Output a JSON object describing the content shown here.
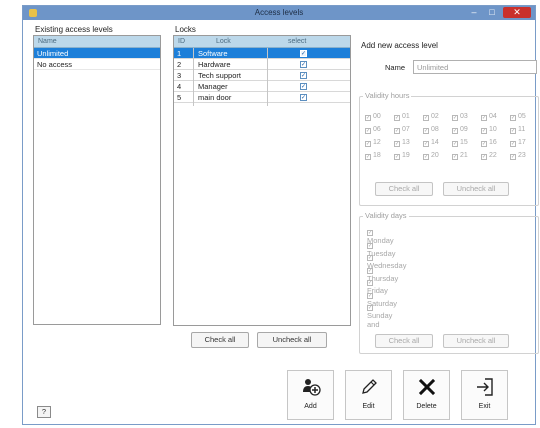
{
  "window": {
    "title": "Access levels",
    "minimize_glyph": "–",
    "maximize_glyph": "□",
    "close_glyph": "✕"
  },
  "existing": {
    "label": "Existing access levels",
    "header": "Name",
    "items": [
      "Unlimited",
      "No access"
    ],
    "selected_index": 0
  },
  "locks": {
    "label": "Locks",
    "columns": {
      "id": "ID",
      "lock": "Lock",
      "select": "select"
    },
    "rows": [
      {
        "id": "1",
        "lock": "Software",
        "selected": true
      },
      {
        "id": "2",
        "lock": "Hardware",
        "selected": true
      },
      {
        "id": "3",
        "lock": "Tech support",
        "selected": true
      },
      {
        "id": "4",
        "lock": "Manager",
        "selected": true
      },
      {
        "id": "5",
        "lock": "main door",
        "selected": true
      }
    ],
    "check_all": "Check all",
    "uncheck_all": "Uncheck all"
  },
  "add_level": {
    "label": "Add new access level",
    "name_label": "Name",
    "name_value": "Unlimited"
  },
  "validity_hours": {
    "label": "Validity hours",
    "hours": [
      "00",
      "01",
      "02",
      "03",
      "04",
      "05",
      "06",
      "07",
      "08",
      "09",
      "10",
      "11",
      "12",
      "13",
      "14",
      "15",
      "16",
      "17",
      "18",
      "19",
      "20",
      "21",
      "22",
      "23"
    ],
    "check_all": "Check all",
    "uncheck_all": "Uncheck all"
  },
  "validity_days": {
    "label": "Validity days",
    "days": [
      "Monday",
      "Tuesday",
      "Wednesday",
      "Thursday",
      "Friday",
      "Saturday",
      "Sunday and"
    ],
    "check_all": "Check all",
    "uncheck_all": "Uncheck all"
  },
  "actions": {
    "add": "Add",
    "edit": "Edit",
    "delete": "Delete",
    "exit": "Exit"
  },
  "help": {
    "label": "?"
  },
  "icons": {
    "add": "add-user-icon",
    "edit": "pencil-icon",
    "delete": "x-icon",
    "exit": "exit-door-icon"
  }
}
